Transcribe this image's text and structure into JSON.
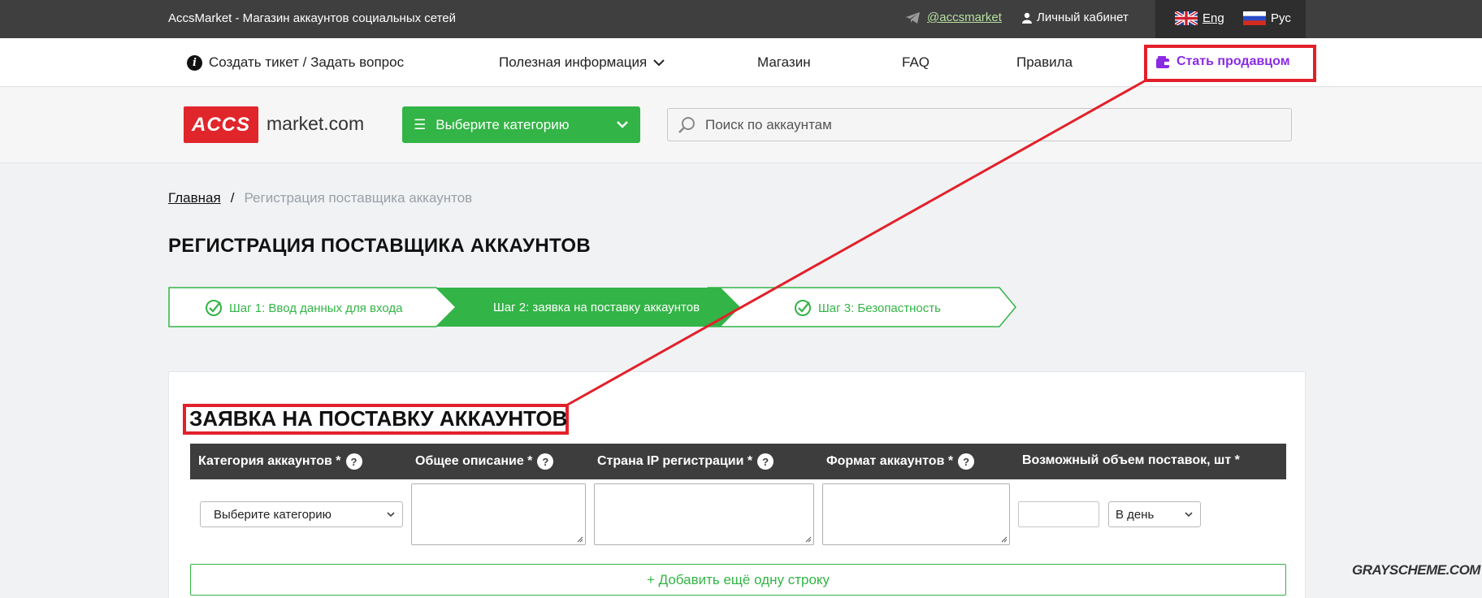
{
  "topbar": {
    "site_title": "AccsMarket - Магазин аккаунтов социальных сетей",
    "telegram": "@accsmarket",
    "cabinet": "Личный кабинет",
    "lang_eng": "Eng",
    "lang_rus": "Рус"
  },
  "nav": {
    "ticket": "Создать тикет / Задать вопрос",
    "useful_info": "Полезная информация",
    "shop": "Магазин",
    "faq": "FAQ",
    "rules": "Правила",
    "become_seller": "Стать продавцом"
  },
  "header": {
    "logo_badge": "ACCS",
    "logo_text": "market.com",
    "category_button": "Выберите категорию",
    "search_placeholder": "Поиск по аккаунтам"
  },
  "breadcrumb": {
    "home": "Главная",
    "separator": "/",
    "current": "Регистрация поставщика аккаунтов"
  },
  "page_title": "РЕГИСТРАЦИЯ ПОСТАВЩИКА АККАУНТОВ",
  "steps": [
    {
      "label": "Шаг 1: Ввод данных для входа",
      "state": "done"
    },
    {
      "label": "Шаг 2: заявка на поставку аккаунтов",
      "state": "active"
    },
    {
      "label": "Шаг 3: Безопастность",
      "state": "done"
    }
  ],
  "form": {
    "title": "ЗАЯВКА НА ПОСТАВКУ АККАУНТОВ",
    "columns": [
      "Категория аккаунтов *",
      "Общее описание *",
      "Страна IP регистрации *",
      "Формат аккаунтов *",
      "Возможный объем поставок, шт *"
    ],
    "help_mark": "?",
    "category_select": "Выберите категорию",
    "period_select": "В день",
    "add_row": "+ Добавить ещё одну строку"
  },
  "watermark": "GRAYSCHEME.COM",
  "colors": {
    "accent_green": "#33b446",
    "highlight_red": "#e2202a",
    "seller_purple": "#8a2be2",
    "topbar": "#3f3f3f"
  }
}
